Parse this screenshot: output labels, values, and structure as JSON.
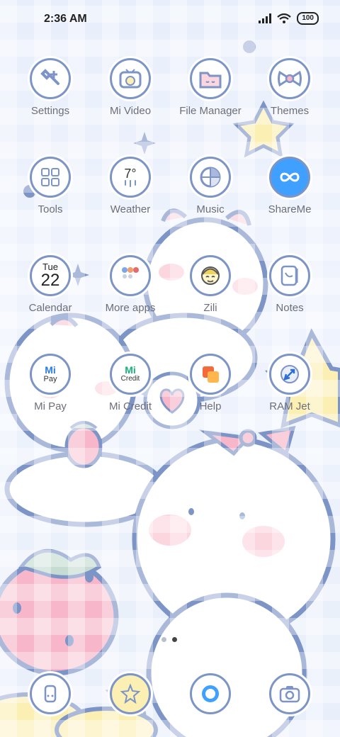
{
  "status": {
    "time": "2:36 AM",
    "battery": "100"
  },
  "apps": [
    {
      "label": "Settings",
      "icon": "gear-wrench-icon"
    },
    {
      "label": "Mi Video",
      "icon": "tv-icon"
    },
    {
      "label": "File Manager",
      "icon": "folder-icon"
    },
    {
      "label": "Themes",
      "icon": "bow-icon"
    },
    {
      "label": "Tools",
      "icon": "tools-icon"
    },
    {
      "label": "Weather",
      "icon": "cloud-icon",
      "value": "7°"
    },
    {
      "label": "Music",
      "icon": "pie-icon"
    },
    {
      "label": "ShareMe",
      "icon": "infinity-icon"
    },
    {
      "label": "Calendar",
      "icon": "calendar-icon",
      "day": "Tue",
      "date": "22"
    },
    {
      "label": "More apps",
      "icon": "grid-apps-icon"
    },
    {
      "label": "Zili",
      "icon": "face-icon"
    },
    {
      "label": "Notes",
      "icon": "notes-icon"
    },
    {
      "label": "Mi Pay",
      "icon": "mi-pay-icon",
      "badge_top": "Mi",
      "badge_bottom": "Pay"
    },
    {
      "label": "Mi Credit",
      "icon": "mi-credit-icon",
      "badge_top": "Mi",
      "badge_bottom": "Credit"
    },
    {
      "label": "Help",
      "icon": "help-icon"
    },
    {
      "label": "RAM Jet",
      "icon": "rocket-icon"
    }
  ],
  "dock": [
    {
      "icon": "phone-icon"
    },
    {
      "icon": "star-face-icon"
    },
    {
      "icon": "browser-icon"
    },
    {
      "icon": "camera-icon"
    }
  ],
  "pager": {
    "pages": 2,
    "active": 2
  },
  "colors": {
    "accent": "#7d94c7",
    "pink": "#f7b6c9",
    "yellow": "#fbefb4"
  }
}
